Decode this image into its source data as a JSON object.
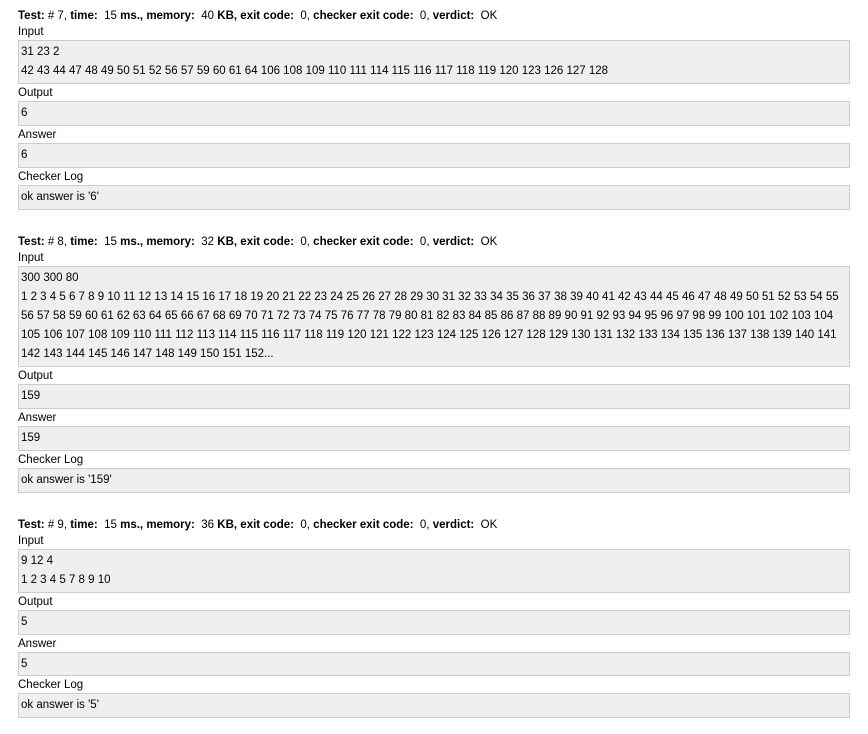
{
  "labels": {
    "test": "Test:",
    "time": "time:",
    "memory": "memory:",
    "exit_code": "exit code:",
    "checker_exit_code": "checker exit code:",
    "verdict": "verdict:",
    "input": "Input",
    "output": "Output",
    "answer": "Answer",
    "checker_log": "Checker Log",
    "time_unit": "ms.,",
    "mem_unit": "KB,"
  },
  "tests": [
    {
      "num": "# 7,",
      "time": "15",
      "memory": "40",
      "exit_code": "0,",
      "checker_exit_code": "0,",
      "verdict": "OK",
      "input": "31 23 2\n42 43 44 47 48 49 50 51 52 56 57 59 60 61 64 106 108 109 110 111 114 115 116 117 118 119 120 123 126 127 128",
      "output": "6",
      "answer": "6",
      "checker_log": "ok answer is '6'"
    },
    {
      "num": "# 8,",
      "time": "15",
      "memory": "32",
      "exit_code": "0,",
      "checker_exit_code": "0,",
      "verdict": "OK",
      "input": "300 300 80\n1 2 3 4 5 6 7 8 9 10 11 12 13 14 15 16 17 18 19 20 21 22 23 24 25 26 27 28 29 30 31 32 33 34 35 36 37 38 39 40 41 42 43 44 45 46 47 48 49 50 51 52 53 54 55 56 57 58 59 60 61 62 63 64 65 66 67 68 69 70 71 72 73 74 75 76 77 78 79 80 81 82 83 84 85 86 87 88 89 90 91 92 93 94 95 96 97 98 99 100 101 102 103 104 105 106 107 108 109 110 111 112 113 114 115 116 117 118 119 120 121 122 123 124 125 126 127 128 129 130 131 132 133 134 135 136 137 138 139 140 141 142 143 144 145 146 147 148 149 150 151 152...",
      "output": "159",
      "answer": "159",
      "checker_log": "ok answer is '159'"
    },
    {
      "num": "# 9,",
      "time": "15",
      "memory": "36",
      "exit_code": "0,",
      "checker_exit_code": "0,",
      "verdict": "OK",
      "input": "9 12 4\n1 2 3 4 5 7 8 9 10",
      "output": "5",
      "answer": "5",
      "checker_log": "ok answer is '5'"
    }
  ]
}
